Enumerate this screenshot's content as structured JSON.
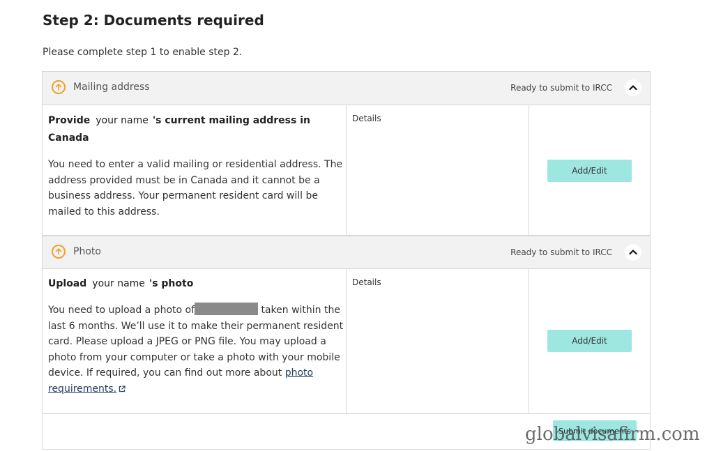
{
  "page": {
    "title": "Step 2: Documents required",
    "intro": "Please complete step 1 to enable step 2."
  },
  "sections": [
    {
      "title": "Mailing address",
      "status": "Ready to submit to IRCC",
      "icon": "arrow-up-circle-icon",
      "heading_prefix": "Provide",
      "heading_name": "your name",
      "heading_suffix": "'s current mailing address in Canada",
      "body": "You need to enter a valid mailing or residential address. The address provided must be in Canada and it cannot be a business address. Your permanent resident card will be mailed to this address.",
      "details_label": "Details",
      "action_label": "Add/Edit"
    },
    {
      "title": "Photo",
      "status": "Ready to submit to IRCC",
      "icon": "arrow-up-circle-icon",
      "heading_prefix": "Upload",
      "heading_name": "your name",
      "heading_suffix": "'s photo",
      "body_before": "You need to upload a photo of",
      "body_after": "taken within the last 6 months. We’ll use it to make their permanent resident card. Please upload a JPEG or PNG file. You may upload a photo from your computer or take a photo with your mobile device. If required, you can find out more about",
      "link_text": "photo requirements.",
      "details_label": "Details",
      "action_label": "Add/Edit"
    }
  ],
  "footer": {
    "submit_label": "Submit documents"
  },
  "watermark": "globalvisafirm.com",
  "colors": {
    "accent_button": "#9ee6e0",
    "icon_orange": "#f0a030",
    "header_bg": "#f2f2f2",
    "link": "#284162"
  }
}
